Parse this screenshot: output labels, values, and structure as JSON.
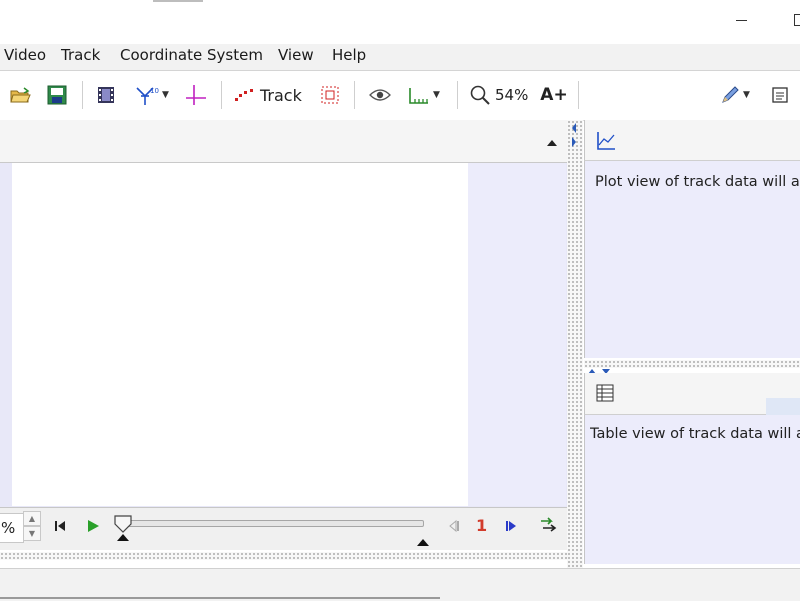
{
  "menu": {
    "items": [
      {
        "label": "Video"
      },
      {
        "label": "Track"
      },
      {
        "label": "Coordinate System"
      },
      {
        "label": "View"
      },
      {
        "label": "Help"
      }
    ]
  },
  "toolbar": {
    "track_label": "Track",
    "zoom_label": "54%",
    "font_size_label": "A+",
    "icons": [
      "open-folder-icon",
      "save-icon",
      "video-clip-icon",
      "calibration-tools-icon",
      "coordinate-axes-icon",
      "track-points-icon",
      "autotracker-icon",
      "eye-icon",
      "measuring-ruler-icon",
      "magnifier-icon",
      "font-size-icon",
      "pencil-icon",
      "notes-icon"
    ]
  },
  "player": {
    "zoom_value": "%",
    "step_count": "1"
  },
  "plot_view": {
    "message": "Plot view of track data will ap"
  },
  "table_view": {
    "message": "Table view of track data will ap"
  },
  "colors": {
    "accent_blue": "#2050c8",
    "magenta": "#c020c0",
    "play_green": "#2aa02a",
    "step_red": "#d23b2b",
    "panel_lavender": "#ececfb"
  }
}
